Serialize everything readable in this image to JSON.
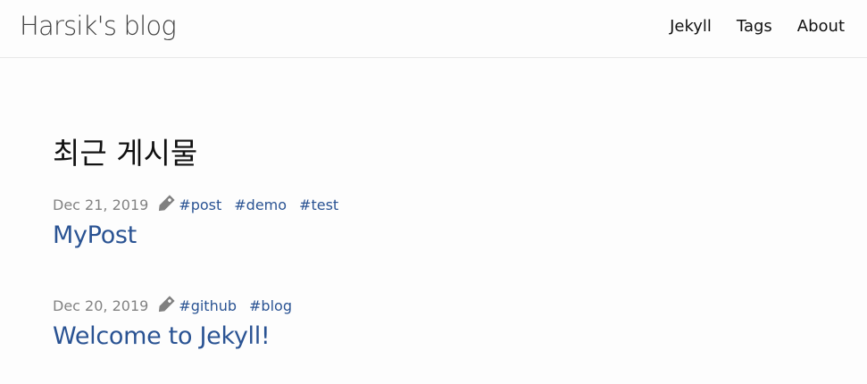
{
  "header": {
    "site_title": "Harsik's blog",
    "nav": [
      {
        "label": "Jekyll"
      },
      {
        "label": "Tags"
      },
      {
        "label": "About"
      }
    ]
  },
  "main": {
    "heading": "최근 게시물",
    "posts": [
      {
        "date": "Dec 21, 2019",
        "tags": [
          "#post",
          "#demo",
          "#test"
        ],
        "title": "MyPost"
      },
      {
        "date": "Dec 20, 2019",
        "tags": [
          "#github",
          "#blog"
        ],
        "title": "Welcome to Jekyll!"
      }
    ]
  },
  "colors": {
    "link": "#2a5393",
    "meta": "#828282",
    "tag_icon": "#808080",
    "background": "#fdfdfd"
  },
  "icons": {
    "tag": "tag-icon"
  }
}
